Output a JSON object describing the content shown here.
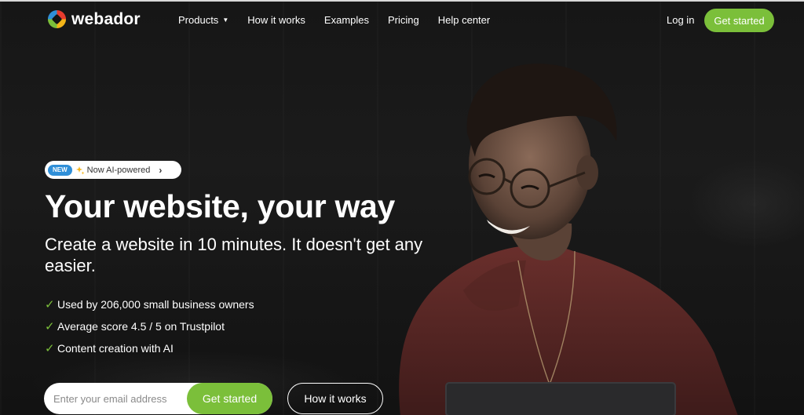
{
  "brand": {
    "name": "webador",
    "colors": {
      "accent": "#7bbf3a",
      "new_badge": "#2f8fd8",
      "background": "#141414"
    }
  },
  "nav": {
    "items": [
      {
        "label": "Products",
        "has_dropdown": true
      },
      {
        "label": "How it works"
      },
      {
        "label": "Examples"
      },
      {
        "label": "Pricing"
      },
      {
        "label": "Help center"
      }
    ],
    "login_label": "Log in",
    "cta_label": "Get started"
  },
  "hero": {
    "badge": {
      "new_label": "NEW",
      "text": "Now AI-powered",
      "icon": "sparkle-icon"
    },
    "headline": "Your website, your way",
    "subheadline": "Create a website in 10 minutes. It doesn't get any easier.",
    "checklist": [
      "Used by 206,000 small business owners",
      "Average score 4.5 / 5 on Trustpilot",
      "Content creation with AI"
    ],
    "email_placeholder": "Enter your email address",
    "email_cta_label": "Get started",
    "secondary_cta_label": "How it works"
  }
}
